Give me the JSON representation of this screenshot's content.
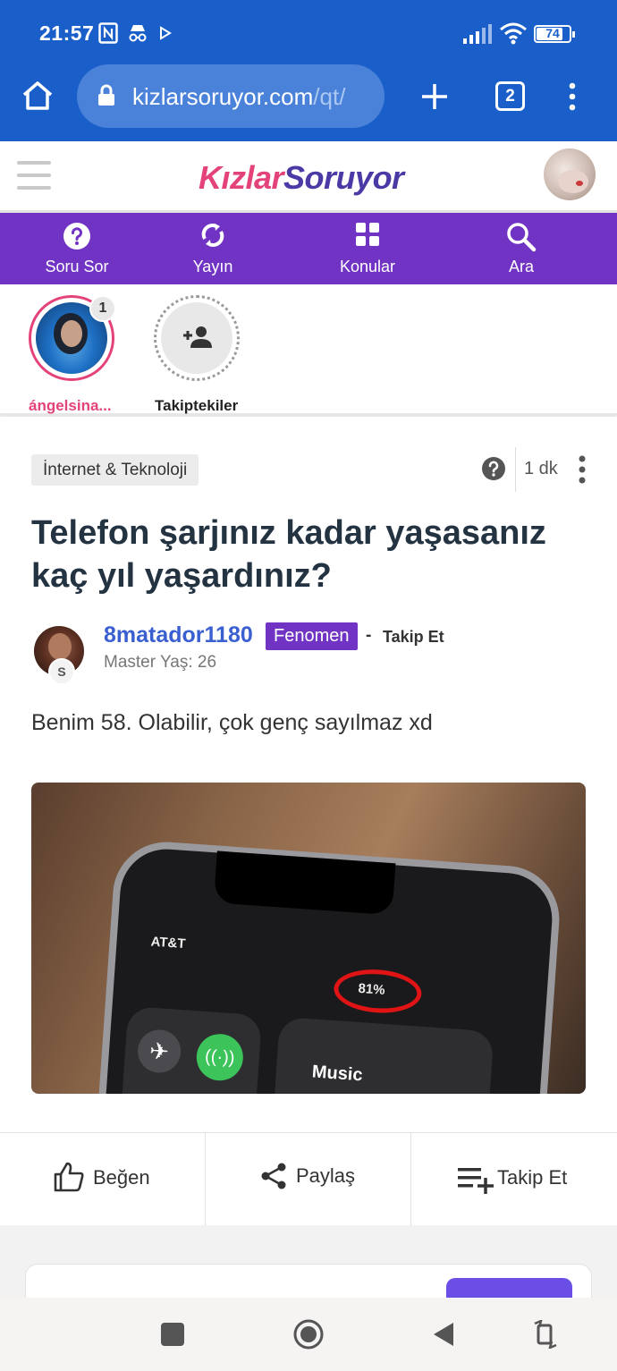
{
  "status_bar": {
    "time": "21:57",
    "battery": "74",
    "icons": [
      "nfc-icon",
      "incognito-icon",
      "play-icon",
      "signal-icon",
      "wifi-icon",
      "battery-icon"
    ]
  },
  "browser": {
    "url_host": "kizlarsoruyor.com",
    "url_path": "/qt/",
    "tab_count": "2",
    "icons": [
      "home-icon",
      "lock-icon",
      "new-tab-icon",
      "menu-icon"
    ]
  },
  "site": {
    "logo_part1": "Kızlar",
    "logo_part2": "Soruyor",
    "accent_color": "#7133c4",
    "nav": [
      {
        "label": "Soru Sor",
        "icon": "question-circle-icon"
      },
      {
        "label": "Yayın",
        "icon": "broadcast-icon"
      },
      {
        "label": "Konular",
        "icon": "grid-icon"
      },
      {
        "label": "Ara",
        "icon": "search-icon"
      }
    ]
  },
  "stories": [
    {
      "name": "ángelsina...",
      "count": "1"
    },
    {
      "name": "Takiptekiler",
      "icon": "add-user-icon"
    }
  ],
  "post": {
    "category": "İnternet & Teknoloji",
    "time": "1 dk",
    "title": "Telefon şarjınız kadar yaşasanız kaç yıl yaşardınız?",
    "author": {
      "name": "8matador1180",
      "rank": "Fenomen",
      "separator": "-",
      "follow": "Takip Et",
      "badge": "S",
      "meta": "Master Yaş: 26"
    },
    "body": "Benim 58. Olabilir, çok genç sayılmaz xd",
    "image": {
      "carrier": "AT&T",
      "battery_text": "81%",
      "music_label": "Music"
    }
  },
  "actions": [
    {
      "label": "Beğen",
      "icon": "thumbs-up-icon"
    },
    {
      "label": "Paylaş",
      "icon": "share-icon"
    },
    {
      "label": "Takip Et",
      "icon": "playlist-add-icon"
    }
  ],
  "android_nav": [
    "square-icon",
    "home-circle-icon",
    "back-triangle-icon",
    "rotate-icon"
  ]
}
